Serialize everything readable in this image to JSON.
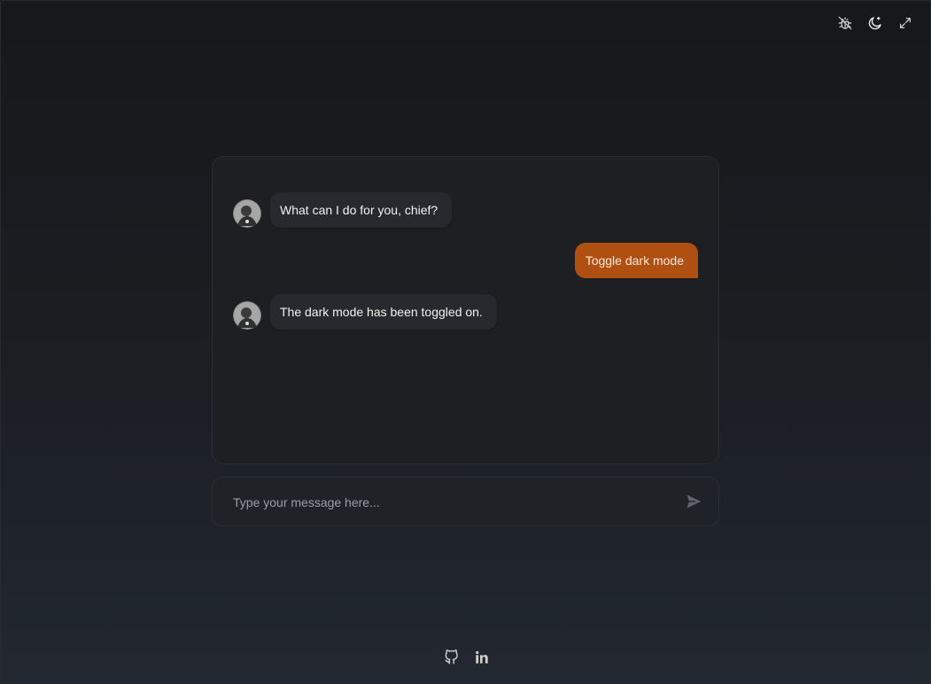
{
  "toolbar": {
    "items": [
      {
        "icon": "bug-off-icon",
        "label": "Disable effects"
      },
      {
        "icon": "moon-icon",
        "label": "Toggle dark mode"
      },
      {
        "icon": "expand-icon",
        "label": "Fullscreen"
      }
    ]
  },
  "chat": {
    "messages": [
      {
        "role": "bot",
        "text": "What can I do for you, chief?"
      },
      {
        "role": "user",
        "text": "Toggle dark mode"
      },
      {
        "role": "bot",
        "text": "The dark mode has been toggled on."
      }
    ]
  },
  "composer": {
    "placeholder": "Type your message here...",
    "value": "",
    "send_icon": "send-icon"
  },
  "footer": {
    "links": [
      {
        "icon": "github-icon"
      },
      {
        "icon": "linkedin-icon"
      }
    ]
  },
  "colors": {
    "accent": "#b04f12",
    "panel": "#1d1f22",
    "bot_bubble": "#26292d"
  }
}
